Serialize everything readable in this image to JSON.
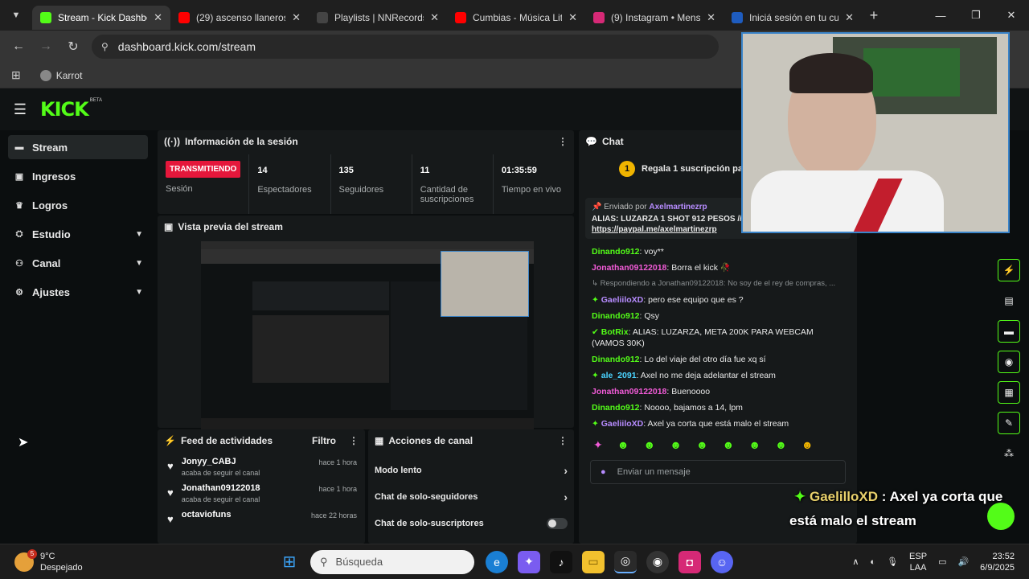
{
  "browser": {
    "tabs": [
      {
        "title": "Stream - Kick Dashboard",
        "color": "#53fc18",
        "active": true
      },
      {
        "title": "(29) ascenso llaneros",
        "color": "#ff0000",
        "active": false
      },
      {
        "title": "Playlists | NNRecords",
        "color": "#444444",
        "active": false
      },
      {
        "title": "Cumbias - Música Lit",
        "color": "#ff0000",
        "active": false
      },
      {
        "title": "(9) Instagram • Mens",
        "color": "#d62976",
        "active": false
      },
      {
        "title": "Iniciá sesión en tu cu",
        "color": "#1e5cbf",
        "active": false
      }
    ],
    "url": "dashboard.kick.com/stream",
    "bookmark": "Karrot"
  },
  "kick": {
    "logo": "KICK",
    "beta": "BETA",
    "sidebar": [
      {
        "label": "Stream",
        "icon": "stream-icon",
        "glyph": "▬",
        "active": true,
        "expand": false
      },
      {
        "label": "Ingresos",
        "icon": "revenue-icon",
        "glyph": "▣",
        "active": false,
        "expand": false
      },
      {
        "label": "Logros",
        "icon": "trophy-icon",
        "glyph": "♛",
        "active": false,
        "expand": false
      },
      {
        "label": "Estudio",
        "icon": "studio-icon",
        "glyph": "⛭",
        "active": false,
        "expand": true
      },
      {
        "label": "Canal",
        "icon": "channel-icon",
        "glyph": "⚇",
        "active": false,
        "expand": true
      },
      {
        "label": "Ajustes",
        "icon": "settings-icon",
        "glyph": "⚙",
        "active": false,
        "expand": true
      }
    ],
    "session": {
      "title": "Información de la sesión",
      "live_badge": "TRANSMITIENDO",
      "live_label": "Sesión",
      "stats": [
        {
          "value": "14",
          "label": "Espectadores"
        },
        {
          "value": "135",
          "label": "Seguidores"
        },
        {
          "value": "11",
          "label": "Cantidad de suscripciones"
        },
        {
          "value": "01:35:59",
          "label": "Tiempo en vivo"
        }
      ]
    },
    "preview": {
      "title": "Vista previa del stream"
    },
    "feed": {
      "title": "Feed de actividades",
      "filter": "Filtro",
      "items": [
        {
          "name": "Jonyy_CABJ",
          "action": "acaba de seguir el canal",
          "time": "hace 1 hora"
        },
        {
          "name": "Jonathan09122018",
          "action": "acaba de seguir el canal",
          "time": "hace 1 hora"
        },
        {
          "name": "octaviofuns",
          "action": "",
          "time": "hace 22 horas"
        }
      ]
    },
    "actions": {
      "title": "Acciones de canal",
      "rows": [
        {
          "label": "Modo lento",
          "control": "arrow"
        },
        {
          "label": "Chat de solo-seguidores",
          "control": "arrow"
        },
        {
          "label": "Chat de solo-suscriptores",
          "control": "toggle"
        }
      ]
    },
    "chat": {
      "title": "Chat",
      "gift_banner": "Regala 1 suscripción para",
      "gift_count": "1",
      "pinned_by_label": "Enviado por",
      "pinned_by": "Axelmartinezrp",
      "pinned_text": "ALIAS: LUZARZA 1 SHOT 912 PESOS // PAYPAL",
      "pinned_link": "https://paypal.me/axelmartinezrp",
      "messages": [
        {
          "user": "Dinando912",
          "text": "voy**",
          "cls": "u-green",
          "icon": ""
        },
        {
          "user": "Jonathan09122018",
          "text": "Borra el kick 🥀",
          "cls": "u-pink",
          "icon": ""
        },
        {
          "user": "",
          "text": "Respondiendo a Jonathan09122018: No soy de el rey de compras, ...",
          "cls": "reply",
          "icon": ""
        },
        {
          "user": "GaeliiloXD",
          "text": "pero ese equipo que es ?",
          "cls": "u-purple",
          "icon": "✦"
        },
        {
          "user": "Dinando912",
          "text": "Qsy",
          "cls": "u-green",
          "icon": ""
        },
        {
          "user": "BotRix",
          "text": "ALIAS: LUZARZA, META 200K PARA WEBCAM (VAMOS 30K)",
          "cls": "u-green",
          "icon": "✔"
        },
        {
          "user": "Dinando912",
          "text": "Lo del viaje del otro día fue xq sí",
          "cls": "u-green",
          "icon": ""
        },
        {
          "user": "ale_2091",
          "text": "Axel no me deja adelantar el stream",
          "cls": "u-cyan",
          "icon": "✦"
        },
        {
          "user": "Jonathan09122018",
          "text": "Buenoooo",
          "cls": "u-pink",
          "icon": ""
        },
        {
          "user": "Dinando912",
          "text": "Noooo, bajamos a 14, lpm",
          "cls": "u-green",
          "icon": ""
        },
        {
          "user": "GaeliiloXD",
          "text": "Axel ya corta que está malo el stream",
          "cls": "u-purple",
          "icon": "✦"
        }
      ],
      "input_placeholder": "Enviar un mensaje"
    }
  },
  "overlay": {
    "user": "GaelilloXD",
    "line1": "Axel ya corta que",
    "line2": "está malo el stream"
  },
  "taskbar": {
    "weather_temp": "9°C",
    "weather_desc": "Despejado",
    "weather_badge": "5",
    "search_placeholder": "Búsqueda",
    "lang": "ESP",
    "lang2": "LAA",
    "time": "23:52",
    "date": "6/9/2025"
  }
}
